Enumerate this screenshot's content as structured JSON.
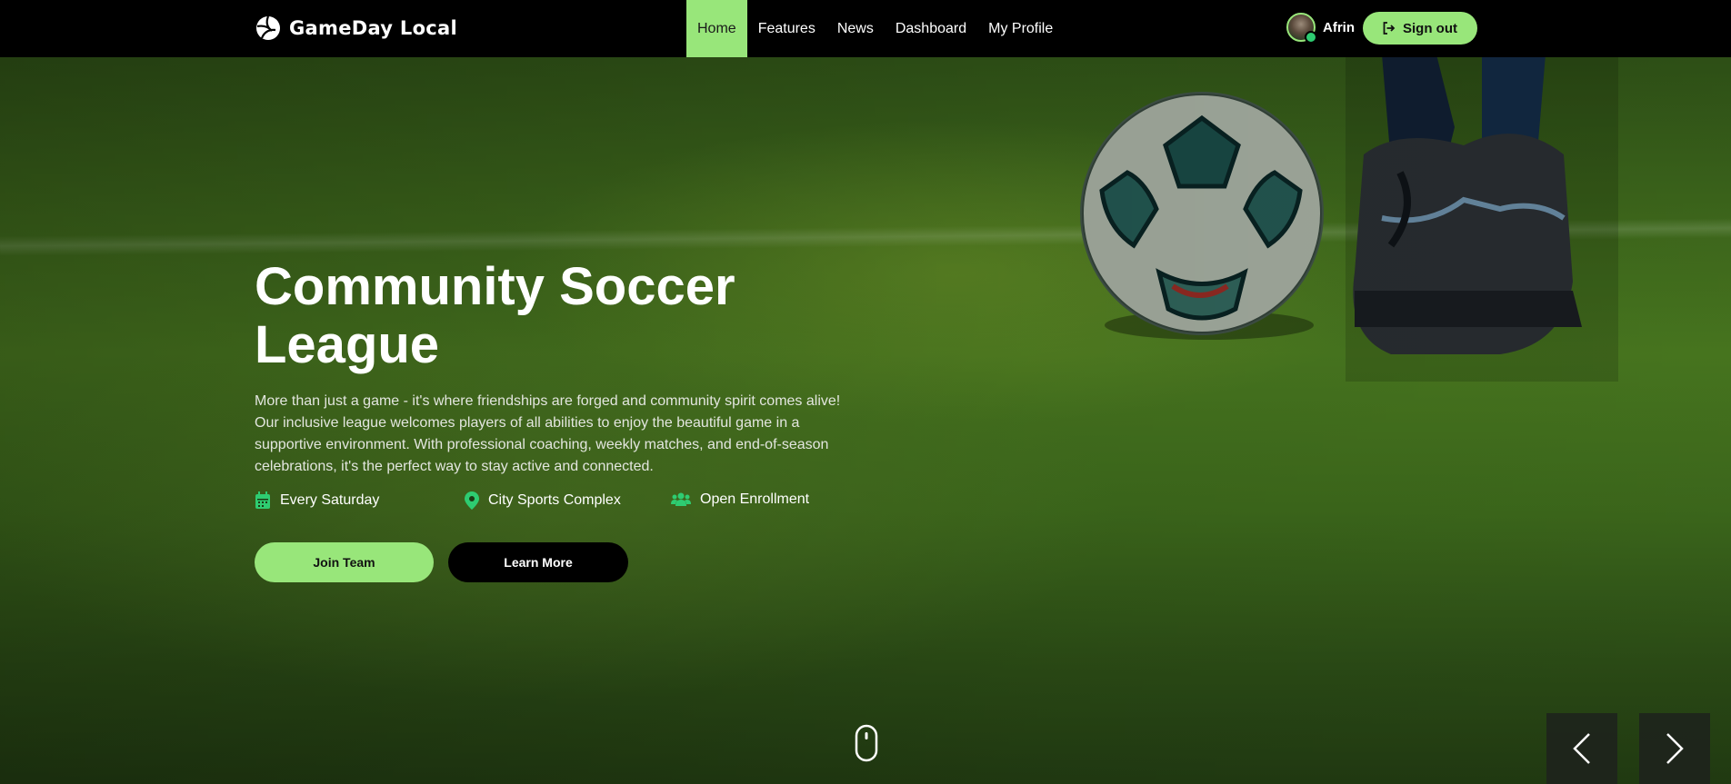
{
  "brand": {
    "name": "GameDay Local"
  },
  "nav": {
    "links": [
      {
        "label": "Home",
        "active": true
      },
      {
        "label": "Features"
      },
      {
        "label": "News"
      },
      {
        "label": "Dashboard"
      },
      {
        "label": "My Profile"
      }
    ]
  },
  "user": {
    "name": "Afrin",
    "status": "online"
  },
  "signout": {
    "label": "Sign out",
    "icon": "sign-out-icon"
  },
  "hero": {
    "title": "Community Soccer League",
    "description": "More than just a game - it's where friendships are forged and community spirit comes alive! Our inclusive league welcomes players of all abilities to enjoy the beautiful game in a supportive environment. With professional coaching, weekly matches, and end-of-season celebrations, it's the perfect way to stay active and connected.",
    "info": [
      {
        "icon": "calendar-icon",
        "label": "Every Saturday"
      },
      {
        "icon": "location-pin-icon",
        "label": "City Sports Complex"
      },
      {
        "icon": "users-icon",
        "label": "Open Enrollment"
      }
    ],
    "buttons": {
      "join": "Join Team",
      "learn": "Learn More"
    }
  },
  "colors": {
    "accent": "#98e67a",
    "icon_green": "#2ecc71",
    "nav_bg": "#000000"
  }
}
